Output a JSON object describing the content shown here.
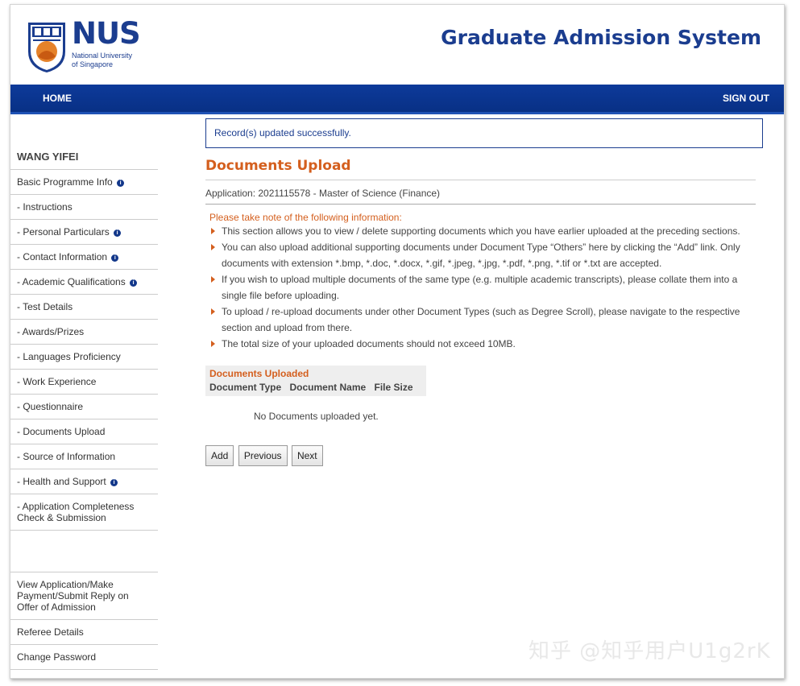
{
  "header": {
    "logo_word": "NUS",
    "logo_sub_line1": "National University",
    "logo_sub_line2": "of Singapore",
    "system_title": "Graduate Admission System"
  },
  "nav": {
    "home": "HOME",
    "sign_out": "SIGN OUT"
  },
  "sidebar": {
    "user_name": "WANG YIFEI",
    "items": [
      {
        "label": "Basic Programme Info",
        "info": true
      },
      {
        "label": "- Instructions",
        "info": false
      },
      {
        "label": "- Personal Particulars",
        "info": true
      },
      {
        "label": "- Contact Information",
        "info": true
      },
      {
        "label": "- Academic Qualifications",
        "info": true
      },
      {
        "label": "- Test Details",
        "info": false
      },
      {
        "label": "- Awards/Prizes",
        "info": false
      },
      {
        "label": "- Languages Proficiency",
        "info": false
      },
      {
        "label": "- Work Experience",
        "info": false
      },
      {
        "label": "- Questionnaire",
        "info": false
      },
      {
        "label": "- Documents Upload",
        "info": false
      },
      {
        "label": "- Source of Information",
        "info": false
      },
      {
        "label": "- Health and Support",
        "info": true
      },
      {
        "label": "- Application Completeness Check & Submission",
        "info": false
      }
    ],
    "bottom_items": [
      {
        "label": "View Application/Make Payment/Submit Reply on Offer of Admission"
      },
      {
        "label": "Referee Details"
      },
      {
        "label": "Change Password"
      }
    ],
    "info_glyph": "i"
  },
  "main": {
    "success_message": "Record(s) updated successfully.",
    "page_title": "Documents Upload",
    "application_line": "Application: 2021115578 - Master of Science (Finance)",
    "note_heading": "Please take note of the following information:",
    "notes": [
      "This section allows you to view / delete supporting documents which you have earlier uploaded at the preceding sections.",
      "You can also upload additional supporting documents under Document Type “Others” here by clicking the “Add” link. Only documents with extension *.bmp, *.doc, *.docx, *.gif, *.jpeg, *.jpg, *.pdf, *.png, *.tif or *.txt are accepted.",
      "If you wish to upload multiple documents of the same type (e.g. multiple academic transcripts), please collate them into a single file before uploading.",
      "To upload / re-upload documents under other Document Types (such as Degree Scroll), please navigate to the respective section and upload from there.",
      "The total size of your uploaded documents should not exceed 10MB."
    ],
    "docs_table": {
      "title": "Documents Uploaded",
      "columns": [
        "Document Type",
        "Document Name",
        "File Size"
      ],
      "empty_message": "No Documents uploaded yet."
    },
    "buttons": {
      "add": "Add",
      "previous": "Previous",
      "next": "Next"
    }
  },
  "watermark": "知乎 @知乎用户U1g2rK",
  "colors": {
    "brand_blue": "#1b3d8f",
    "nav_blue": "#0d3a9a",
    "accent_orange": "#d45f1e"
  }
}
